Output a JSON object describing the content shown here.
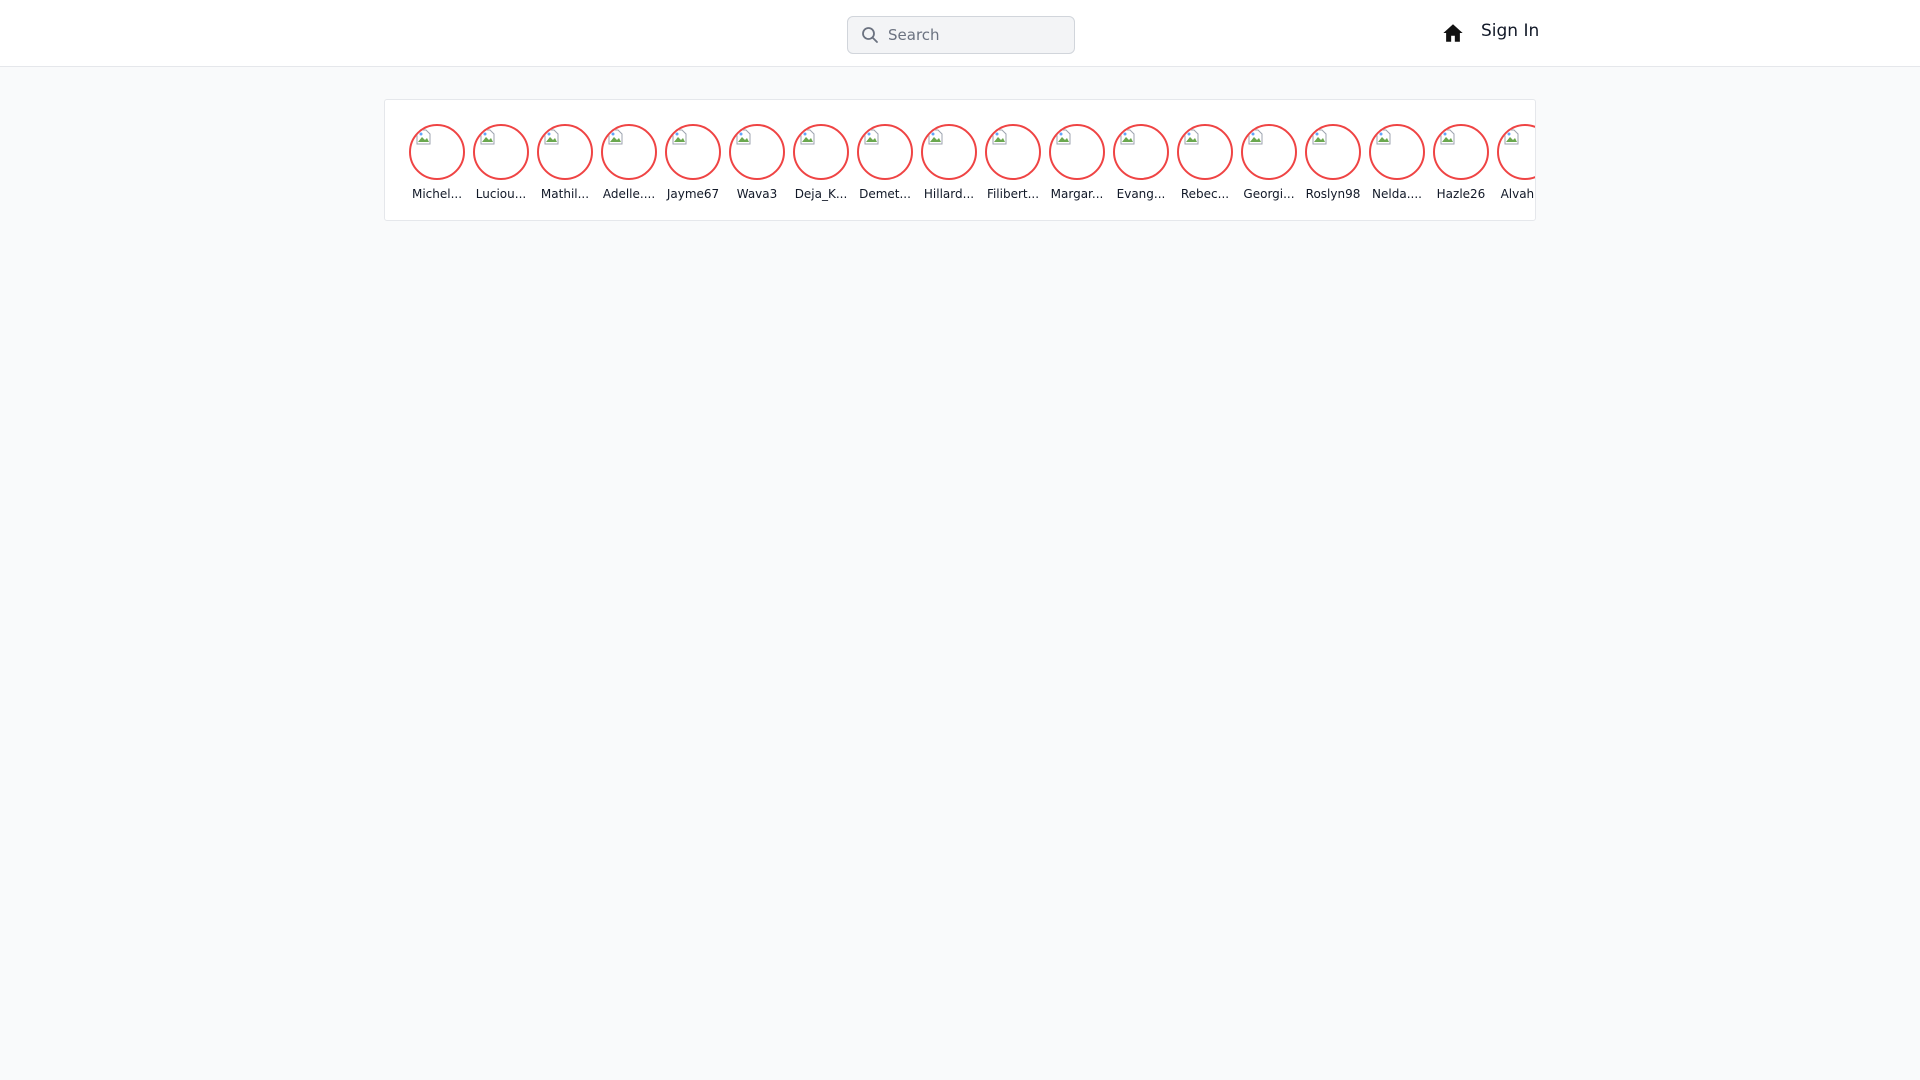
{
  "header": {
    "search": {
      "placeholder": "Search",
      "value": ""
    },
    "home_icon": "home-icon",
    "signin_label": "Sign In"
  },
  "stories": {
    "users": [
      {
        "username": "Michel..."
      },
      {
        "username": "Luciou..."
      },
      {
        "username": "Mathil..."
      },
      {
        "username": "Adelle...."
      },
      {
        "username": "Jayme67"
      },
      {
        "username": "Wava3"
      },
      {
        "username": "Deja_K..."
      },
      {
        "username": "Demet..."
      },
      {
        "username": "Hillard..."
      },
      {
        "username": "Filibert..."
      },
      {
        "username": "Margar..."
      },
      {
        "username": "Evang..."
      },
      {
        "username": "Rebec..."
      },
      {
        "username": "Georgi..."
      },
      {
        "username": "Roslyn98"
      },
      {
        "username": "Nelda...."
      },
      {
        "username": "Hazle26"
      },
      {
        "username": "Alvah...."
      }
    ]
  },
  "colors": {
    "accent_ring": "#ef4444",
    "background": "#f9fafb",
    "surface": "#ffffff"
  }
}
